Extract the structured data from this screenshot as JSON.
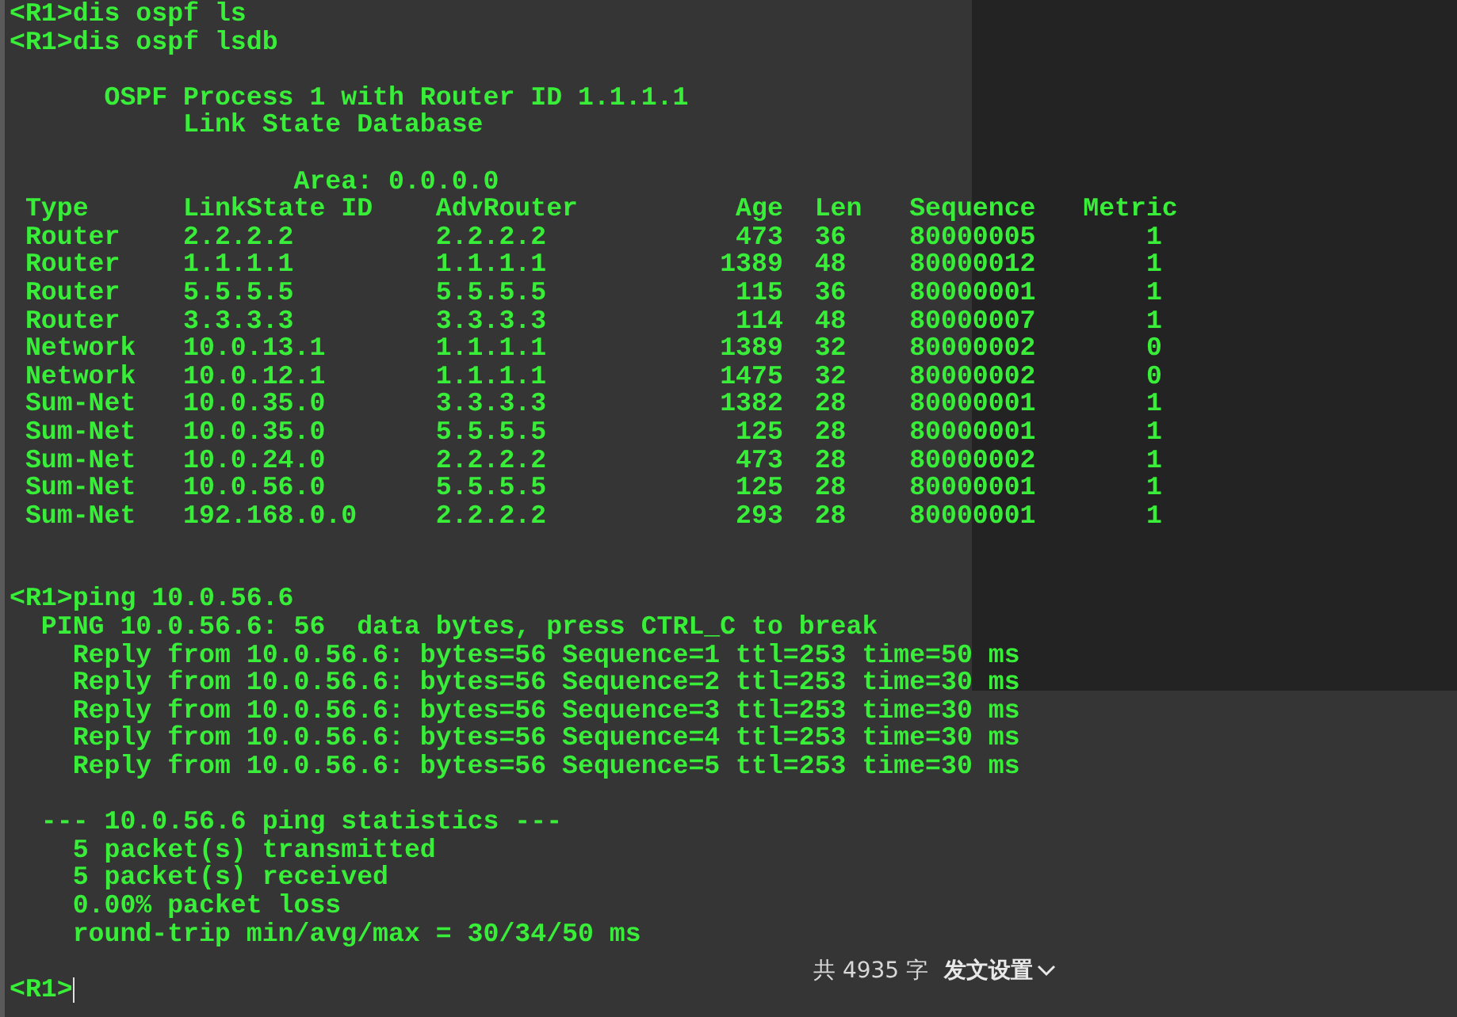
{
  "terminal": {
    "lines": [
      {
        "kind": "text",
        "text": "<R1>dis ospf ls"
      },
      {
        "kind": "text",
        "text": "<R1>dis ospf lsdb"
      },
      {
        "kind": "blank"
      },
      {
        "kind": "text",
        "text": "      OSPF Process 1 with Router ID 1.1.1.1"
      },
      {
        "kind": "text",
        "text": "           Link State Database"
      },
      {
        "kind": "blank"
      },
      {
        "kind": "text",
        "text": "                  Area: 0.0.0.0"
      },
      {
        "kind": "text",
        "text": " Type      LinkState ID    AdvRouter          Age  Len   Sequence   Metric"
      },
      {
        "kind": "text",
        "text": " Router    2.2.2.2         2.2.2.2            473  36    80000005       1"
      },
      {
        "kind": "text",
        "text": " Router    1.1.1.1         1.1.1.1           1389  48    80000012       1"
      },
      {
        "kind": "text",
        "text": " Router    5.5.5.5         5.5.5.5            115  36    80000001       1"
      },
      {
        "kind": "text",
        "text": " Router    3.3.3.3         3.3.3.3            114  48    80000007       1"
      },
      {
        "kind": "text",
        "text": " Network   10.0.13.1       1.1.1.1           1389  32    80000002       0"
      },
      {
        "kind": "text",
        "text": " Network   10.0.12.1       1.1.1.1           1475  32    80000002       0"
      },
      {
        "kind": "text",
        "text": " Sum-Net   10.0.35.0       3.3.3.3           1382  28    80000001       1"
      },
      {
        "kind": "text",
        "text": " Sum-Net   10.0.35.0       5.5.5.5            125  28    80000001       1"
      },
      {
        "kind": "text",
        "text": " Sum-Net   10.0.24.0       2.2.2.2            473  28    80000002       1"
      },
      {
        "kind": "text",
        "text": " Sum-Net   10.0.56.0       5.5.5.5            125  28    80000001       1"
      },
      {
        "kind": "text",
        "text": " Sum-Net   192.168.0.0     2.2.2.2            293  28    80000001       1"
      },
      {
        "kind": "blank"
      },
      {
        "kind": "blank"
      },
      {
        "kind": "text",
        "text": "<R1>ping 10.0.56.6"
      },
      {
        "kind": "text",
        "text": "  PING 10.0.56.6: 56  data bytes, press CTRL_C to break"
      },
      {
        "kind": "text",
        "text": "    Reply from 10.0.56.6: bytes=56 Sequence=1 ttl=253 time=50 ms"
      },
      {
        "kind": "text",
        "text": "    Reply from 10.0.56.6: bytes=56 Sequence=2 ttl=253 time=30 ms"
      },
      {
        "kind": "text",
        "text": "    Reply from 10.0.56.6: bytes=56 Sequence=3 ttl=253 time=30 ms"
      },
      {
        "kind": "text",
        "text": "    Reply from 10.0.56.6: bytes=56 Sequence=4 ttl=253 time=30 ms"
      },
      {
        "kind": "text",
        "text": "    Reply from 10.0.56.6: bytes=56 Sequence=5 ttl=253 time=30 ms"
      },
      {
        "kind": "blank"
      },
      {
        "kind": "text",
        "text": "  --- 10.0.56.6 ping statistics ---"
      },
      {
        "kind": "text",
        "text": "    5 packet(s) transmitted"
      },
      {
        "kind": "text",
        "text": "    5 packet(s) received"
      },
      {
        "kind": "text",
        "text": "    0.00% packet loss"
      },
      {
        "kind": "text",
        "text": "    round-trip min/avg/max = 30/34/50 ms"
      },
      {
        "kind": "blank"
      },
      {
        "kind": "prompt",
        "text": "<R1>"
      }
    ]
  },
  "status_bar": {
    "word_count": "共 4935 字",
    "publish_settings": "发文设置"
  }
}
